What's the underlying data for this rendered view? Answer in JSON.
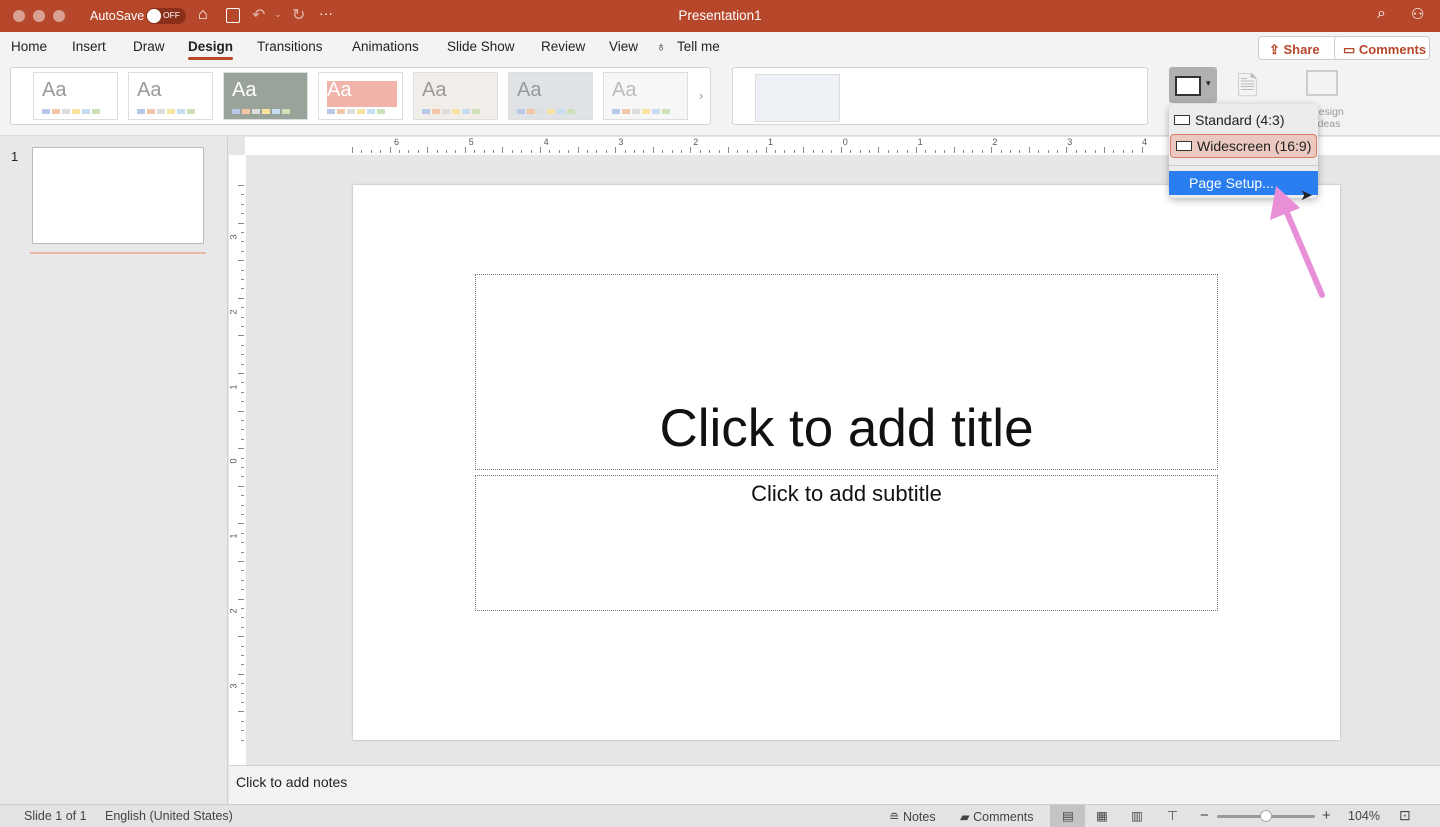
{
  "window": {
    "title": "Presentation1",
    "autosave_label": "AutoSave",
    "autosave_state": "OFF"
  },
  "tabs": [
    {
      "label": "Home"
    },
    {
      "label": "Insert"
    },
    {
      "label": "Draw"
    },
    {
      "label": "Design",
      "active": true
    },
    {
      "label": "Transitions"
    },
    {
      "label": "Animations"
    },
    {
      "label": "Slide Show"
    },
    {
      "label": "Review"
    },
    {
      "label": "View"
    },
    {
      "label": "Tell me"
    }
  ],
  "header_buttons": {
    "share": "Share",
    "comments": "Comments"
  },
  "themes": [
    {
      "label": "Aa"
    },
    {
      "label": "Aa"
    },
    {
      "label": "Aa"
    },
    {
      "label": "Aa"
    },
    {
      "label": "Aa"
    },
    {
      "label": "Aa"
    },
    {
      "label": "Aa"
    }
  ],
  "design_ideas": {
    "label": "Design Ideas"
  },
  "slide_size_menu": {
    "items": [
      {
        "label": "Standard (4:3)"
      },
      {
        "label": "Widescreen (16:9)",
        "selected": true
      },
      {
        "label": "Page Setup...",
        "highlighted": true
      }
    ]
  },
  "ruler": {
    "horizontal": [
      "6",
      "5",
      "4",
      "3",
      "2",
      "1",
      "0",
      "1",
      "2",
      "3",
      "4"
    ],
    "vertical": [
      "3",
      "2",
      "1",
      "0",
      "1",
      "2",
      "3"
    ]
  },
  "thumbnails": [
    {
      "number": "1"
    }
  ],
  "slide": {
    "title_placeholder": "Click to add title",
    "subtitle_placeholder": "Click to add subtitle"
  },
  "notes": {
    "placeholder": "Click to add notes"
  },
  "status": {
    "slide_info": "Slide 1 of 1",
    "language": "English (United States)",
    "notes": "Notes",
    "comments": "Comments",
    "zoom": "104%",
    "zoom_fraction": 0.5
  },
  "colors": {
    "brand": "#b7472a",
    "menu_highlight": "#2a7ef0",
    "annotation_arrow": "#e88fd8"
  }
}
